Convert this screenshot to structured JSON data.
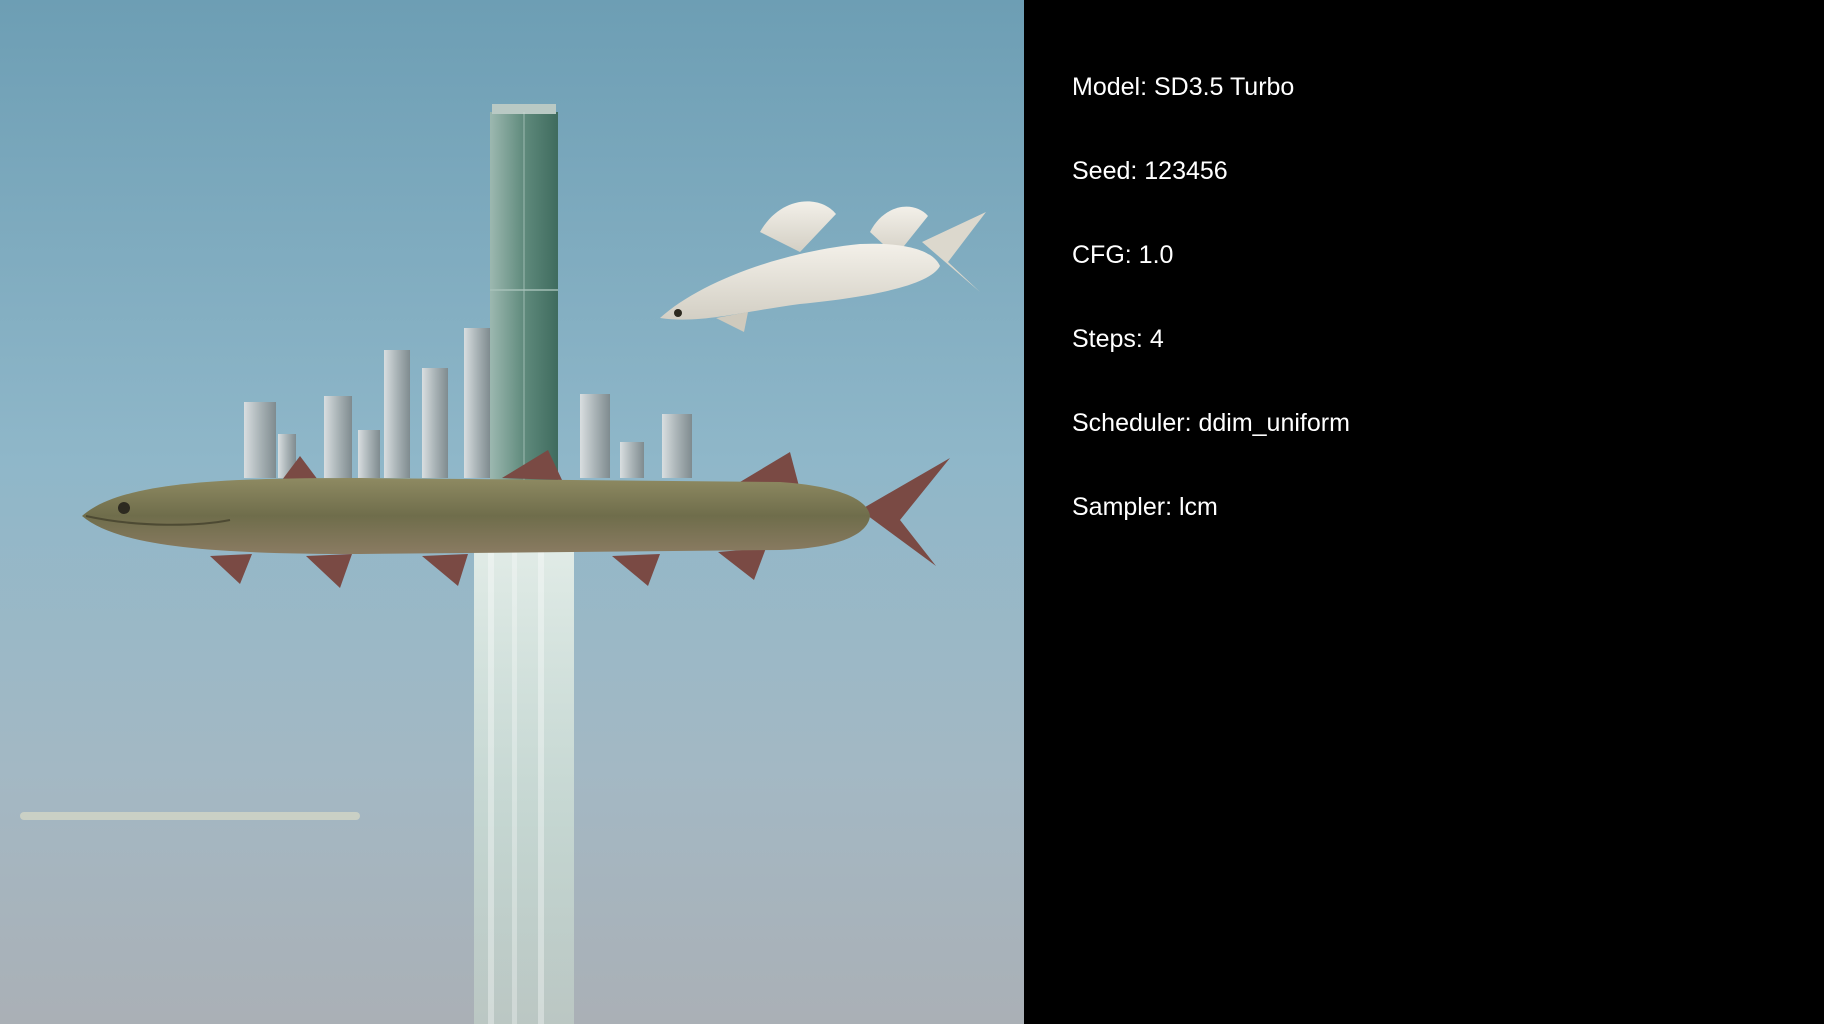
{
  "colors": {
    "background": "#000000",
    "text": "#ffffff",
    "sky_top": "#6f9fb5",
    "sky_bottom": "#a9b3bd"
  },
  "generation_info": {
    "model": "Model: SD3.5 Turbo",
    "seed": "Seed: 123456",
    "cfg": "CFG: 1.0",
    "steps": "Steps: 4",
    "scheduler": "Scheduler: ddim_uniform",
    "sampler": "Sampler: lcm"
  }
}
